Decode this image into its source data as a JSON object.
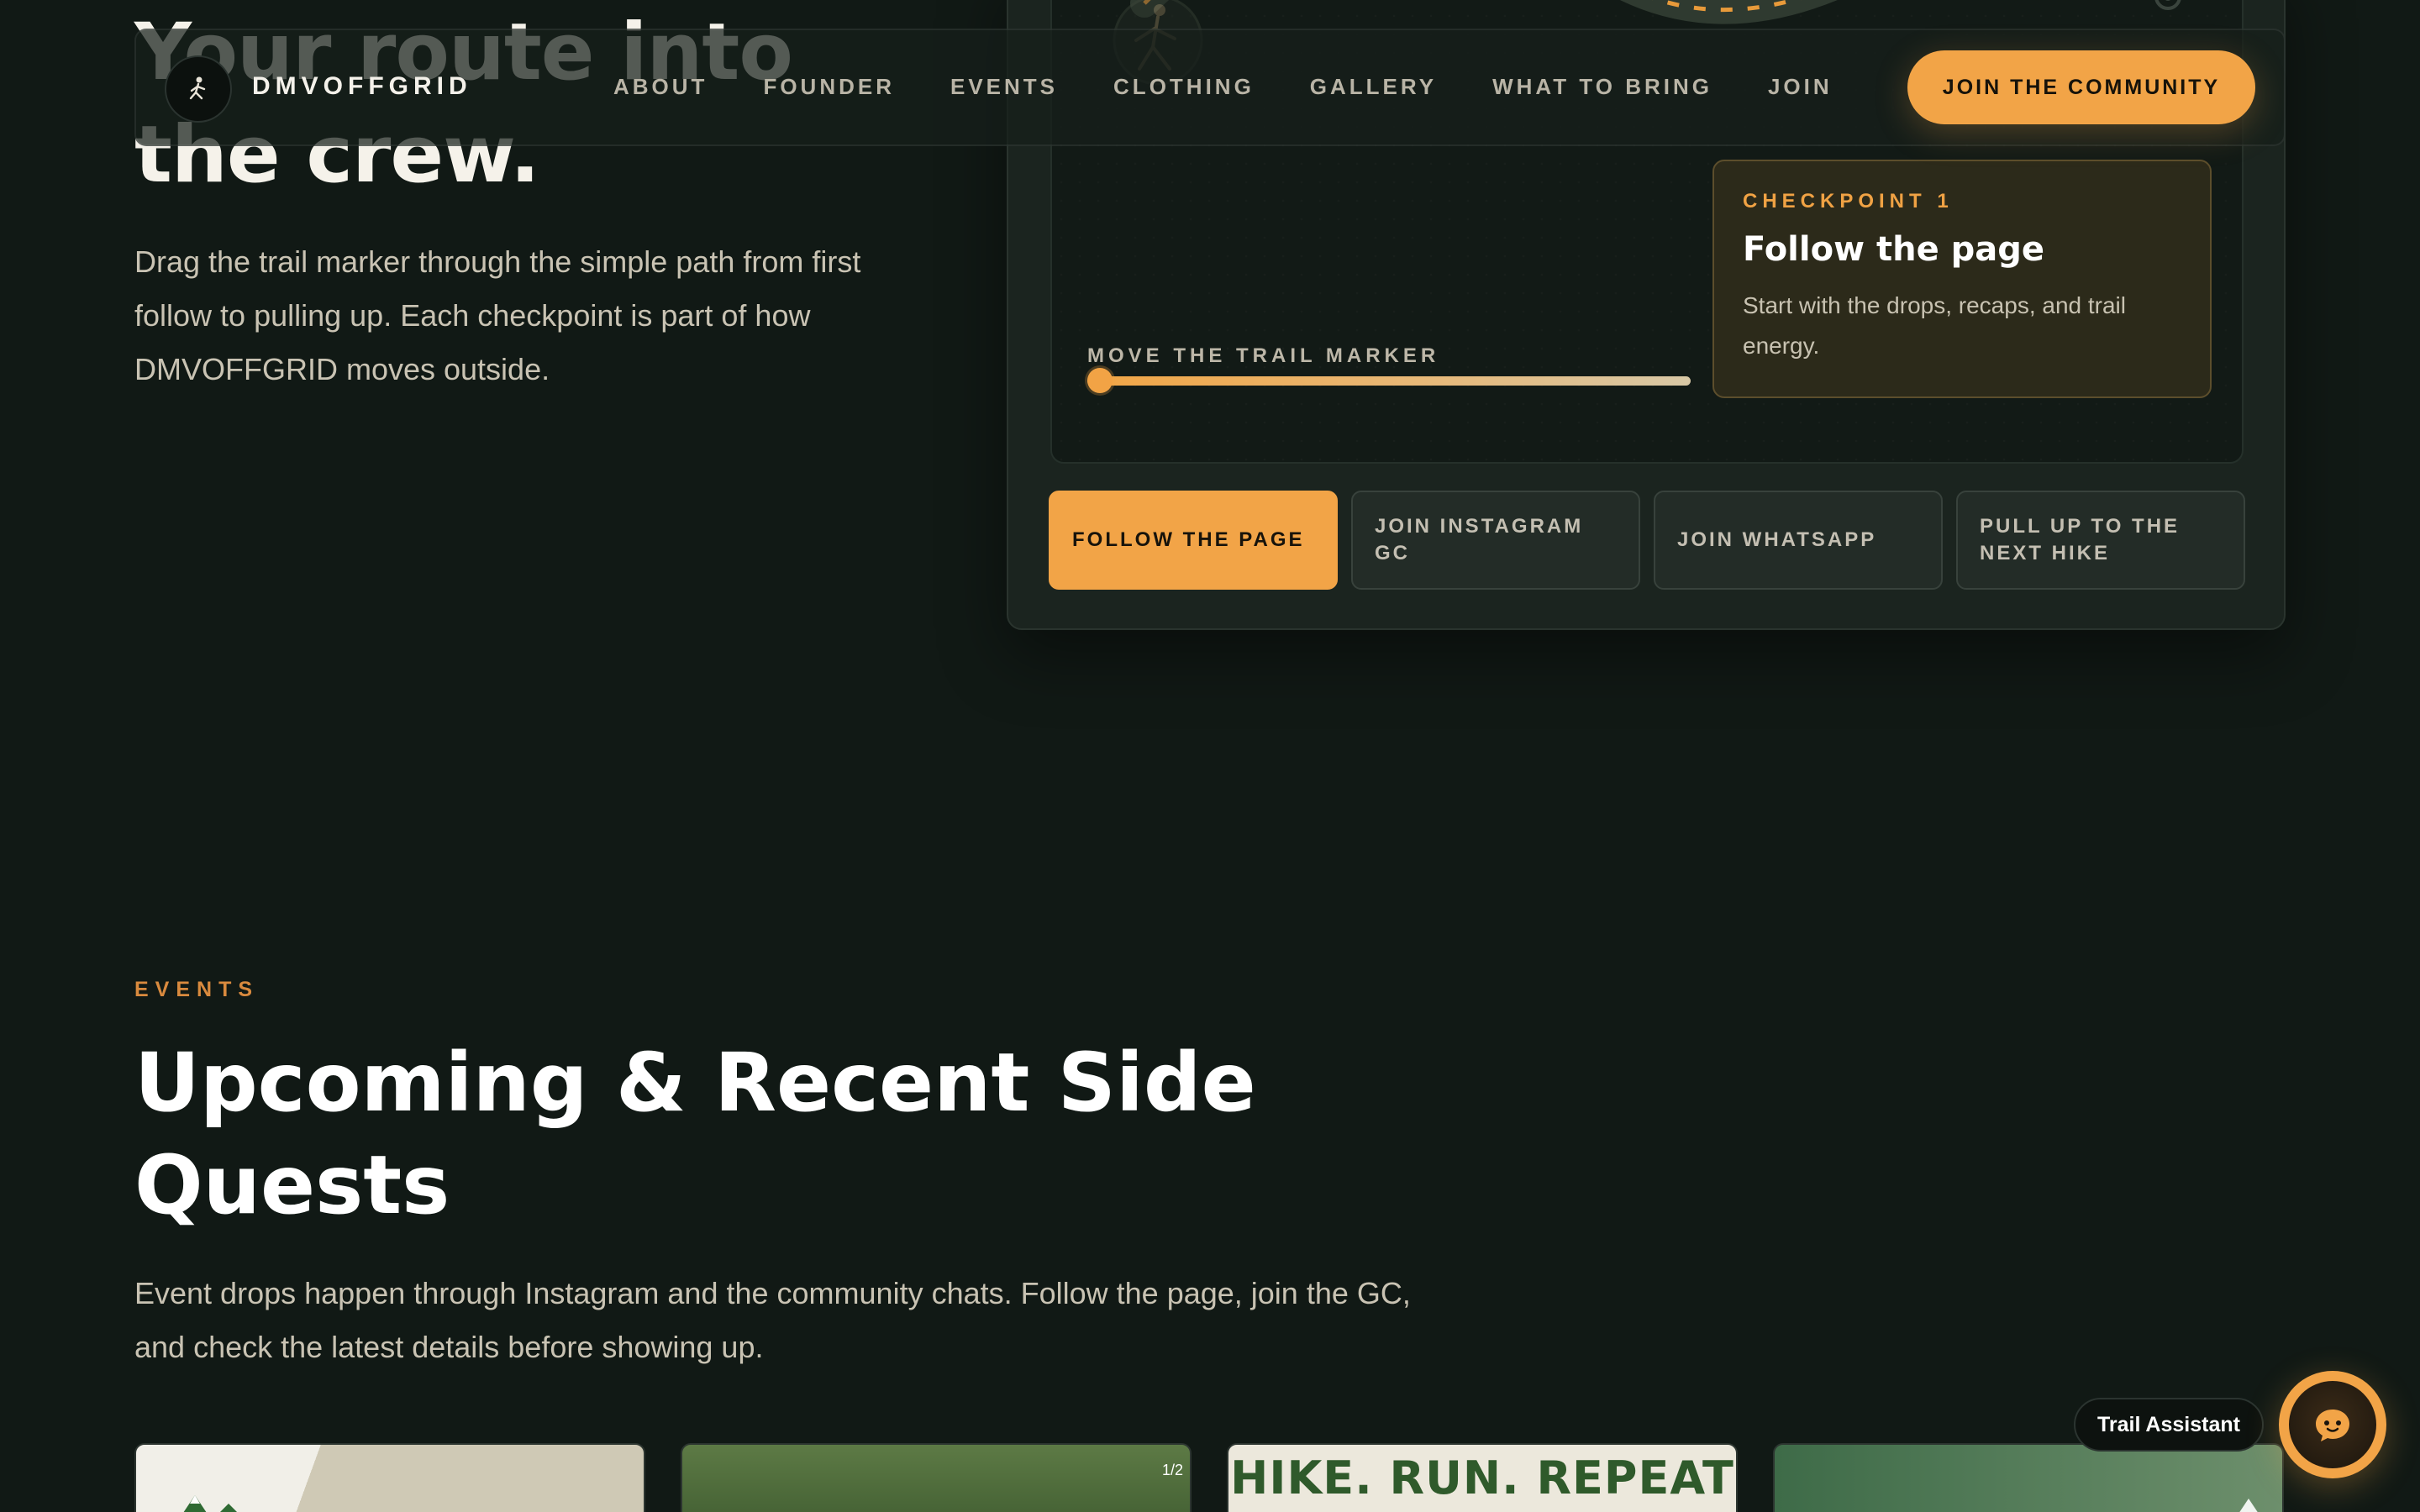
{
  "hero": {
    "title": "Your route into the crew.",
    "description": "Drag the trail marker through the simple path from first follow to pulling up. Each checkpoint is part of how DMVOFFGRID moves outside."
  },
  "trail": {
    "marker_label": "MOVE THE TRAIL MARKER",
    "marker_progress": 0,
    "checkpoint": {
      "kicker": "CHECKPOINT 1",
      "title": "Follow the page",
      "description": "Start with the drops, recaps, and trail energy."
    },
    "steps": [
      {
        "label": "FOLLOW THE PAGE",
        "active": true
      },
      {
        "label": "JOIN INSTAGRAM GC",
        "active": false
      },
      {
        "label": "JOIN WHATSAPP",
        "active": false
      },
      {
        "label": "PULL UP TO THE NEXT HIKE",
        "active": false
      }
    ]
  },
  "nav": {
    "brand": "DMVOFFGRID",
    "logo_icon": "hiker-icon",
    "links": [
      "ABOUT",
      "FOUNDER",
      "EVENTS",
      "CLOTHING",
      "GALLERY",
      "WHAT TO BRING",
      "JOIN"
    ],
    "cta": "JOIN THE COMMUNITY"
  },
  "events": {
    "kicker": "EVENTS",
    "title": "Upcoming & Recent Side Quests",
    "description": "Event drops happen through Instagram and the community chats. Follow the page, join the GC, and check the latest details before showing up.",
    "cards": [
      {
        "counter": "",
        "headline": ""
      },
      {
        "counter": "1/2",
        "headline": ""
      },
      {
        "counter": "",
        "headline": "HIKE. RUN. REPEAT"
      },
      {
        "counter": "",
        "headline": ""
      }
    ]
  },
  "assistant": {
    "label": "Trail Assistant",
    "icon": "chat-bubble-icon"
  },
  "colors": {
    "background": "#111915",
    "accent": "#f2a447",
    "checkpoint_bg": "#2c2a1a",
    "card_bg": "#1b241f"
  }
}
